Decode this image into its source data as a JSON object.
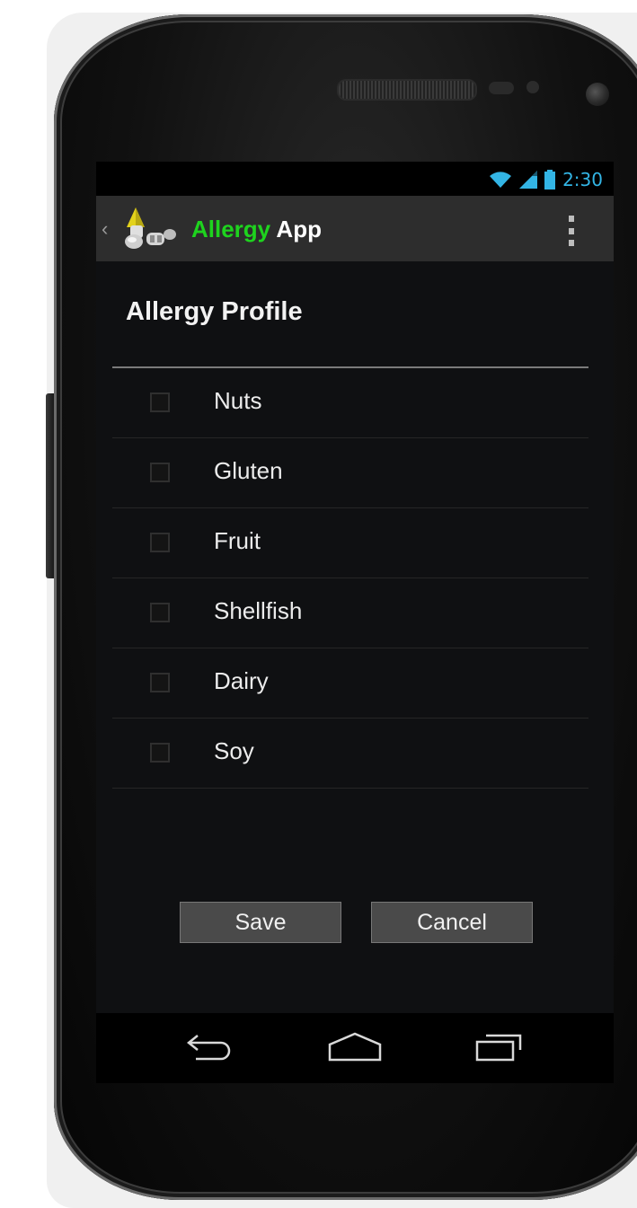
{
  "status_bar": {
    "time": "2:30",
    "icons": [
      "wifi-icon",
      "signal-icon",
      "battery-icon"
    ],
    "accent_color": "#33b5e5"
  },
  "action_bar": {
    "title_accent": "Allergy",
    "title_rest": "App",
    "accent_color": "#1ed31e",
    "icons": [
      "up-caret-icon",
      "app-logo-icon",
      "overflow-menu-icon"
    ]
  },
  "page": {
    "title": "Allergy Profile"
  },
  "allergies": [
    {
      "label": "Nuts",
      "checked": false
    },
    {
      "label": "Gluten",
      "checked": false
    },
    {
      "label": "Fruit",
      "checked": false
    },
    {
      "label": "Shellfish",
      "checked": false
    },
    {
      "label": "Dairy",
      "checked": false
    },
    {
      "label": "Soy",
      "checked": false
    }
  ],
  "buttons": {
    "save": "Save",
    "cancel": "Cancel"
  },
  "nav_bar": {
    "icons": [
      "back-icon",
      "home-icon",
      "recent-apps-icon"
    ]
  }
}
